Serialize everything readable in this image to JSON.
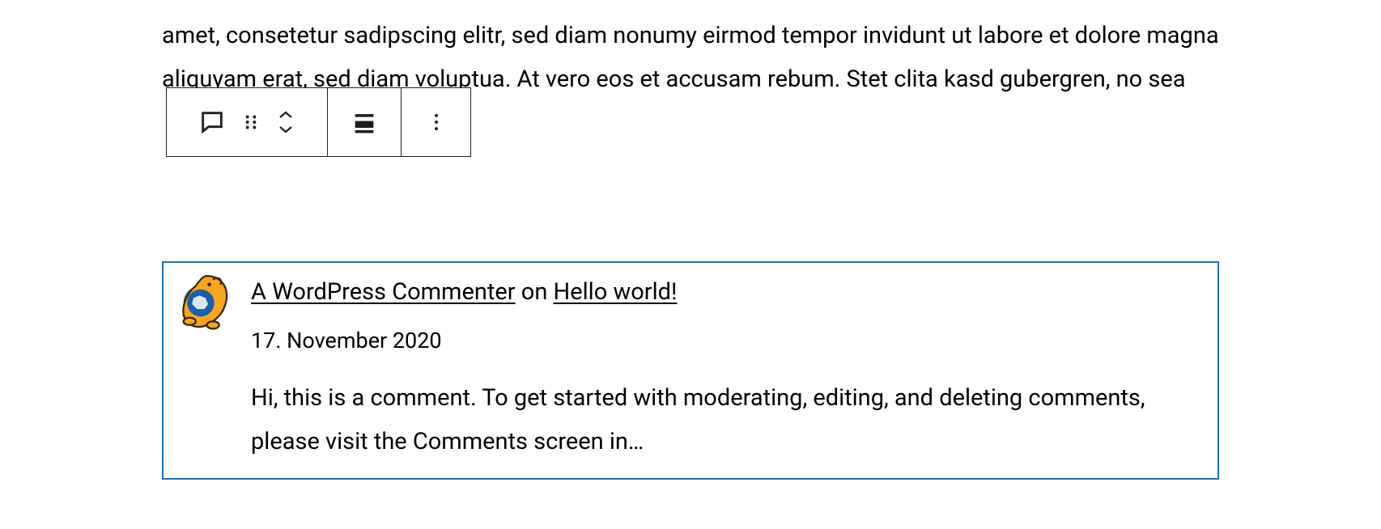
{
  "paragraph": {
    "text": "amet, consetetur sadipscing elitr, sed diam nonumy eirmod tempor invidunt ut labore et dolore magna aliquyam erat, sed diam voluptua. At vero eos et accusam                                     rebum. Stet clita kasd gubergren, no sea"
  },
  "toolbar": {
    "block_type": "Latest Comments",
    "drag": "Drag",
    "move_up": "Move up",
    "move_down": "Move down",
    "align": "Align",
    "more": "Options"
  },
  "comment": {
    "author": "A WordPress Commenter",
    "separator": "on",
    "post_title": "Hello world!",
    "date": "17. November 2020",
    "body": "Hi, this is a comment. To get started with moderating, editing, and deleting comments, please visit the Comments screen in…"
  }
}
